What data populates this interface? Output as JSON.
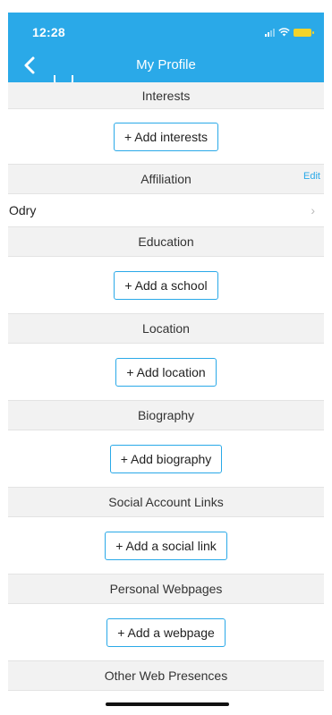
{
  "status": {
    "time": "12:28"
  },
  "nav": {
    "title": "My Profile"
  },
  "sections": {
    "interests": {
      "title": "Interests",
      "button": "+ Add interests"
    },
    "affiliation": {
      "title": "Affiliation",
      "edit": "Edit",
      "value": "Odry"
    },
    "education": {
      "title": "Education",
      "button": "+ Add a school"
    },
    "location": {
      "title": "Location",
      "button": "+ Add location"
    },
    "biography": {
      "title": "Biography",
      "button": "+ Add biography"
    },
    "social": {
      "title": "Social Account Links",
      "button": "+ Add a social link"
    },
    "webpages": {
      "title": "Personal Webpages",
      "button": "+ Add a webpage"
    },
    "other": {
      "title": "Other Web Presences"
    }
  },
  "colors": {
    "accent": "#2aa9e8",
    "battery": "#f2d32b"
  }
}
